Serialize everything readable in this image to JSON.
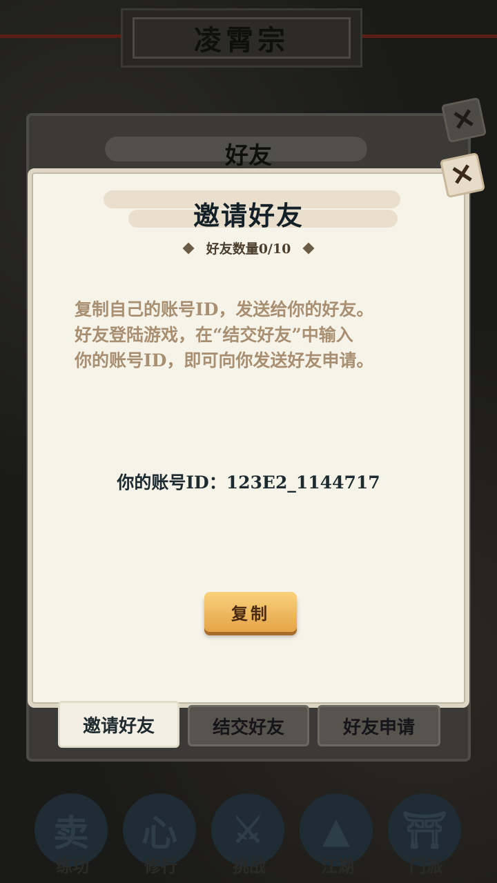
{
  "header": {
    "sect_title": "凌霄宗"
  },
  "friends_panel": {
    "title": "好友"
  },
  "invite_dialog": {
    "title": "邀请好友",
    "friend_count": "好友数量0/10",
    "instructions": [
      "复制自己的账号ID，发送给你的好友。",
      "好友登陆游戏，在“结交好友”中输入",
      "你的账号ID，即可向你发送好友申请。"
    ],
    "account_label": "你的账号ID：123E2_1144717",
    "copy_button": "复制"
  },
  "tabs": [
    {
      "label": "邀请好友",
      "active": true
    },
    {
      "label": "结交好友",
      "active": false
    },
    {
      "label": "好友申请",
      "active": false
    }
  ],
  "bottom_nav": [
    {
      "label": "练功",
      "icon": "fist-icon",
      "glyph": "卖"
    },
    {
      "label": "修行",
      "icon": "heart-icon",
      "glyph": "心"
    },
    {
      "label": "挑战",
      "icon": "crossed-swords-icon",
      "glyph": "⚔"
    },
    {
      "label": "江湖",
      "icon": "mountain-icon",
      "glyph": "▲"
    },
    {
      "label": "门派",
      "icon": "gate-icon",
      "glyph": "⛩"
    }
  ],
  "colors": {
    "dialog_bg": "#f6f3e9",
    "instruction_text": "#a88f72",
    "copy_button": "#e6a448"
  }
}
